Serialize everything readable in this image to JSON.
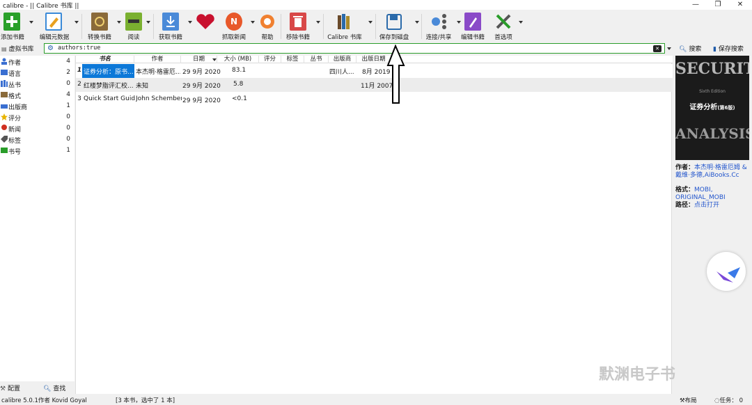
{
  "window": {
    "title": "calibre - || Calibre 书库 ||",
    "btn_min": "—",
    "btn_max": "❐",
    "btn_close": "✕"
  },
  "toolbar": {
    "add": "添加书籍",
    "edit_meta": "编辑元数据",
    "convert": "转换书籍",
    "read": "阅读",
    "get_books": "获取书籍",
    "fetch_news": "抓取新闻",
    "help": "帮助",
    "remove": "移除书籍",
    "library": "Calibre 书库",
    "save": "保存到磁盘",
    "connect": "连接/共享",
    "edit_book": "编辑书籍",
    "prefs": "首选项"
  },
  "search": {
    "virtual_library": "虚拟书库",
    "query": "authors:true",
    "search_button": "搜索",
    "saved_search": "保存搜索"
  },
  "categories": [
    {
      "label": "作者",
      "count": "4",
      "color": "#3a6fd1"
    },
    {
      "label": "语言",
      "count": "2",
      "color": "#3a6fd1"
    },
    {
      "label": "丛书",
      "count": "0",
      "color": "#3a6fd1"
    },
    {
      "label": "格式",
      "count": "4",
      "color": "#8a6a3a"
    },
    {
      "label": "出版商",
      "count": "1",
      "color": "#3a6fd1"
    },
    {
      "label": "评分",
      "count": "0",
      "color": "#e8b400"
    },
    {
      "label": "新闻",
      "count": "0",
      "color": "#d03020"
    },
    {
      "label": "标签",
      "count": "0",
      "color": "#555555"
    },
    {
      "label": "书号",
      "count": "1",
      "color": "#2a9d2a"
    }
  ],
  "left_bottom": {
    "configure": "配置",
    "find": "查找"
  },
  "table": {
    "headers": [
      "书名",
      "作者",
      "日期",
      "大小 (MB)",
      "评分",
      "标签",
      "丛书",
      "出版商",
      "出版日期"
    ],
    "rows": [
      {
        "num": "1",
        "title": "证券分析：原书...",
        "author": "本杰明·格雷厄...",
        "date": "29 9月 2020",
        "size": "83.1",
        "publisher": "四川人...",
        "pubdate": "8月 2019"
      },
      {
        "num": "2",
        "title": "红楼梦脂评汇校...",
        "author": "未知",
        "date": "29 9月 2020",
        "size": "5.8",
        "publisher": "",
        "pubdate": "11月 2007"
      },
      {
        "num": "3",
        "title": "Quick Start Guide",
        "author": "John Schember",
        "date": "29 9月 2020",
        "size": "<0.1",
        "publisher": "",
        "pubdate": ""
      }
    ]
  },
  "details": {
    "cover_top": "SECURITY",
    "cover_edition": "Sixth Edition",
    "cover_cn": "证券分析",
    "cover_cn_small": "(第6版)",
    "cover_bottom": "ANALYSIS",
    "author_label": "作者：",
    "author_value": "本杰明·格雷厄姆 & 戴维·多德,AiBooks.Cc",
    "format_label": "格式：",
    "format_value": "MOBI, ORIGINAL_MOBI",
    "path_label": "路径：",
    "path_value": "点击打开"
  },
  "status": {
    "left": "calibre 5.0.1作者 Kovid Goyal",
    "books": "[3 本书，选中了 1 本]",
    "layout": "布局",
    "jobs": "任务： 0"
  },
  "watermark": "默渊电子书",
  "colors": {
    "accent_blue": "#0c78d8",
    "search_border": "#2a9d2a"
  }
}
